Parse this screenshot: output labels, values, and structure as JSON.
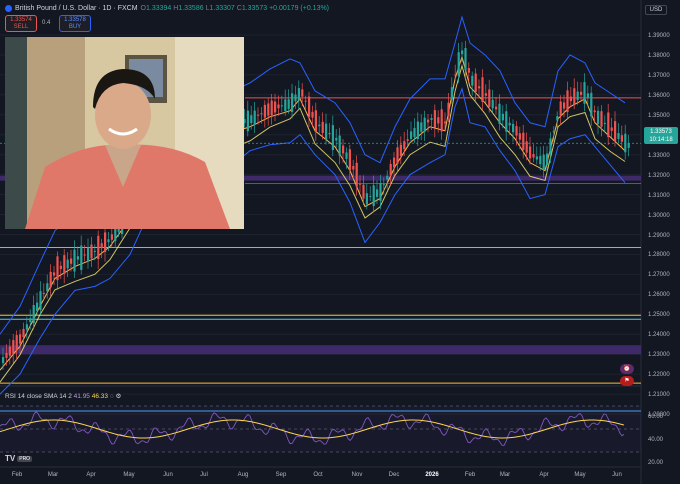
{
  "header": {
    "title": "British Pound / U.S. Dollar · 1D · FXCM",
    "ohlc": {
      "o_label": "O",
      "o": "1.33394",
      "h_label": "H",
      "h": "1.33586",
      "l_label": "L",
      "l": "1.33307",
      "c_label": "C",
      "c": "1.33573",
      "change": "+0.00179 (+0.13%)"
    }
  },
  "trade": {
    "sell_price": "1.33574",
    "sell_label": "SELL",
    "spread": "0.4",
    "buy_price": "1.33578",
    "buy_label": "BUY"
  },
  "currency": "USD",
  "price_tag": {
    "price": "1.33573",
    "countdown": "10:14:18"
  },
  "price_axis": [
    "1.39000",
    "1.38000",
    "1.37000",
    "1.36000",
    "1.35000",
    "1.34000",
    "1.33000",
    "1.32000",
    "1.31000",
    "1.30000",
    "1.29000",
    "1.28000",
    "1.27000",
    "1.26000",
    "1.25000",
    "1.24000",
    "1.23000",
    "1.22000",
    "1.21000",
    "1.20000"
  ],
  "rsi": {
    "label": "RSI 14 close SMA 14 2",
    "value1": "41.95",
    "value2": "46.33",
    "axis": [
      "60.00",
      "40.00",
      "20.00"
    ]
  },
  "time_axis": [
    {
      "label": "Feb",
      "bold": false
    },
    {
      "label": "Mar",
      "bold": false
    },
    {
      "label": "Apr",
      "bold": false
    },
    {
      "label": "May",
      "bold": false
    },
    {
      "label": "Jun",
      "bold": false
    },
    {
      "label": "Jul",
      "bold": false
    },
    {
      "label": "Aug",
      "bold": false
    },
    {
      "label": "Sep",
      "bold": false
    },
    {
      "label": "Oct",
      "bold": false
    },
    {
      "label": "Nov",
      "bold": false
    },
    {
      "label": "Dec",
      "bold": false
    },
    {
      "label": "2026",
      "bold": true
    },
    {
      "label": "Feb",
      "bold": false
    },
    {
      "label": "Mar",
      "bold": false
    },
    {
      "label": "Apr",
      "bold": false
    },
    {
      "label": "May",
      "bold": false
    },
    {
      "label": "Jun",
      "bold": false
    }
  ],
  "logo": {
    "mark": "TV",
    "badge": "PRO"
  },
  "colors": {
    "background": "#131722",
    "up": "#26a69a",
    "down": "#ef5350",
    "bollinger": "#2962ff",
    "rsi_line": "#7e57c2",
    "rsi_sma": "#ffd54f",
    "zone": "#4a2f7a"
  }
}
